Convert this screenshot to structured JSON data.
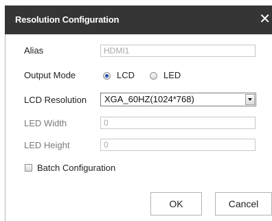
{
  "dialog": {
    "title": "Resolution Configuration",
    "close_glyph": "✕"
  },
  "form": {
    "alias": {
      "label": "Alias",
      "value": "HDMI1"
    },
    "output_mode": {
      "label": "Output Mode",
      "options": [
        {
          "label": "LCD",
          "checked": true
        },
        {
          "label": "LED",
          "checked": false
        }
      ]
    },
    "lcd_resolution": {
      "label": "LCD Resolution",
      "value": "XGA_60HZ(1024*768)"
    },
    "led_width": {
      "label": "LED Width",
      "value": "0"
    },
    "led_height": {
      "label": "LED Height",
      "value": "0"
    },
    "batch": {
      "label": "Batch Configuration",
      "checked": false
    }
  },
  "buttons": {
    "ok": "OK",
    "cancel": "Cancel"
  },
  "colors": {
    "titlebar": "#353535",
    "title_text": "#ffffff",
    "radio_dot": "#2050b0"
  }
}
